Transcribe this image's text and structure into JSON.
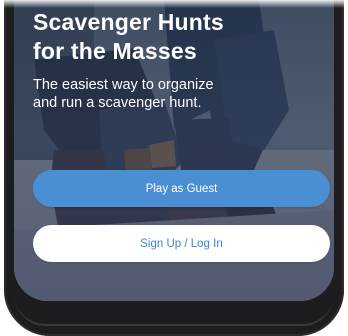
{
  "hero": {
    "title_line1": "Scavenger Hunts",
    "title_line2": "for the Masses",
    "subtitle_line1": "The easiest way to organize",
    "subtitle_line2": "and run a scavenger hunt."
  },
  "actions": {
    "guest_label": "Play as Guest",
    "signup_label": "Sign Up / Log In"
  },
  "colors": {
    "primary_button": "#4a8fd4",
    "secondary_button_text": "#3d86c9",
    "phone_frame": "#1d1d20"
  },
  "background_image": "people-huddled-on-pavement-photo"
}
